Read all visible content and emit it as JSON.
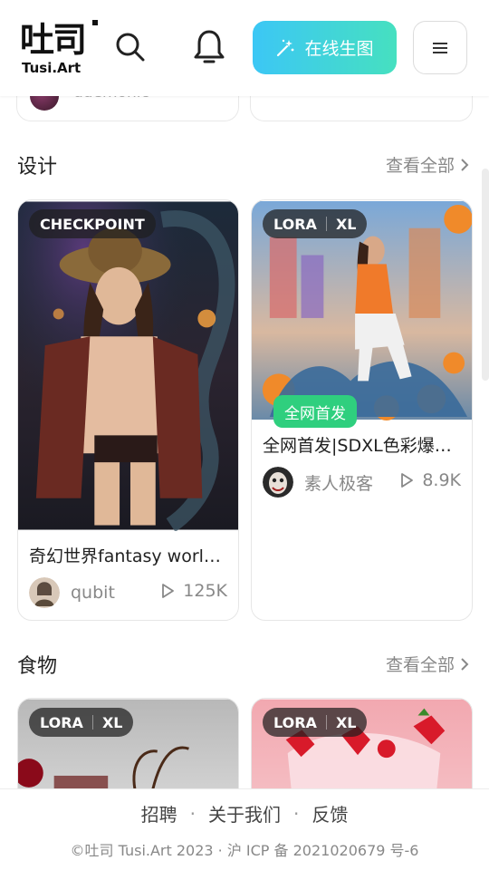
{
  "header": {
    "logo_cn": "吐司",
    "logo_en": "Tusi.Art",
    "create_label": "在线生图"
  },
  "prev_row": {
    "left_author": "ddemonic"
  },
  "sections": [
    {
      "title": "设计",
      "view_all": "查看全部",
      "cards": [
        {
          "badge": [
            "CHECKPOINT"
          ],
          "title": "奇幻世界fantasy worl…",
          "author": "qubit",
          "plays": "125K"
        },
        {
          "badge": [
            "LORA",
            "XL"
          ],
          "tag": "全网首发",
          "title": "全网首发|SDXL色彩爆…",
          "author": "素人极客",
          "plays": "8.9K"
        }
      ]
    },
    {
      "title": "食物",
      "view_all": "查看全部",
      "cards": [
        {
          "badge": [
            "LORA",
            "XL"
          ]
        },
        {
          "badge": [
            "LORA",
            "XL"
          ]
        }
      ]
    }
  ],
  "footer": {
    "links": [
      "招聘",
      "关于我们",
      "反馈"
    ],
    "copyright": "©吐司 Tusi.Art 2023 · 沪 ICP 备 2021020679 号-6"
  },
  "colors": {
    "accent_gradient_start": "#3cc7f5",
    "accent_gradient_end": "#46e0c0",
    "green_tag": "#2fcf7e"
  }
}
